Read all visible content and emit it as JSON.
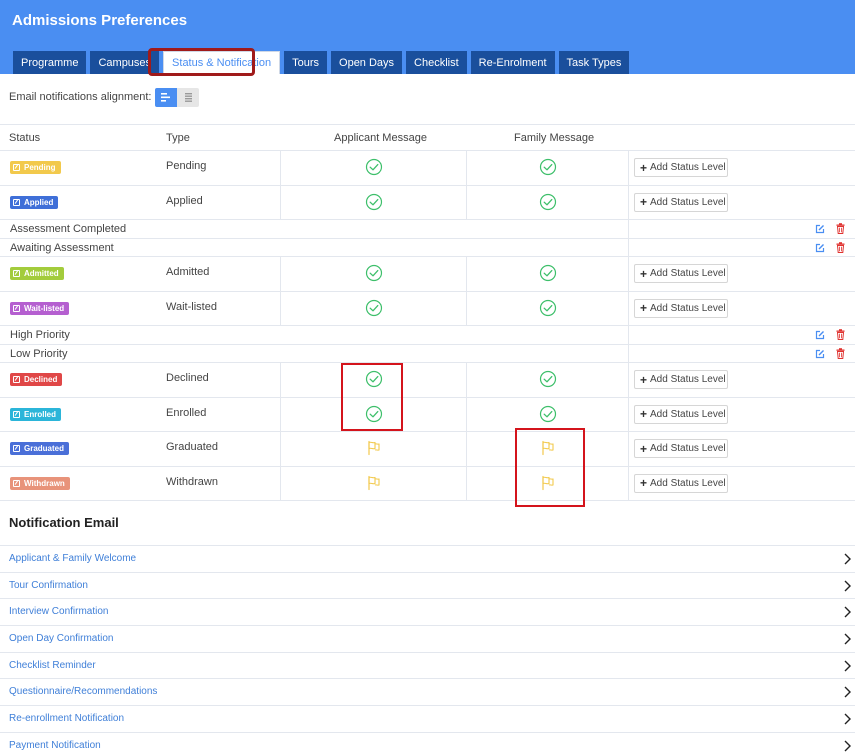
{
  "app": {
    "title": "Admissions Preferences"
  },
  "tabs": [
    {
      "label": "Programme",
      "active": false
    },
    {
      "label": "Campuses",
      "active": false
    },
    {
      "label": "Status & Notification",
      "active": true
    },
    {
      "label": "Tours",
      "active": false
    },
    {
      "label": "Open Days",
      "active": false
    },
    {
      "label": "Checklist",
      "active": false
    },
    {
      "label": "Re-Enrolment",
      "active": false
    },
    {
      "label": "Task Types",
      "active": false
    }
  ],
  "alignment": {
    "label": "Email notifications alignment:",
    "selected": "left"
  },
  "table": {
    "headers": {
      "status": "Status",
      "type": "Type",
      "applicant": "Applicant Message",
      "family": "Family Message"
    },
    "add_label": "Add Status Level",
    "rows": [
      {
        "kind": "status",
        "badge": "Pending",
        "color": "#f2c94c",
        "type": "Pending",
        "applicant": "check",
        "family": "check"
      },
      {
        "kind": "status",
        "badge": "Applied",
        "color": "#3f6fd8",
        "type": "Applied",
        "applicant": "check",
        "family": "check"
      },
      {
        "kind": "level",
        "label": "Assessment Completed"
      },
      {
        "kind": "level",
        "label": "Awaiting Assessment"
      },
      {
        "kind": "status",
        "badge": "Admitted",
        "color": "#a3cc3c",
        "type": "Admitted",
        "applicant": "check",
        "family": "check"
      },
      {
        "kind": "status",
        "badge": "Wait-listed",
        "color": "#b55fd0",
        "type": "Wait-listed",
        "applicant": "check",
        "family": "check"
      },
      {
        "kind": "level",
        "label": "High Priority"
      },
      {
        "kind": "level",
        "label": "Low Priority"
      },
      {
        "kind": "status",
        "badge": "Declined",
        "color": "#e04747",
        "type": "Declined",
        "applicant": "check",
        "family": "check"
      },
      {
        "kind": "status",
        "badge": "Enrolled",
        "color": "#2bb5d9",
        "type": "Enrolled",
        "applicant": "check",
        "family": "check"
      },
      {
        "kind": "status",
        "badge": "Graduated",
        "color": "#4a6fd8",
        "type": "Graduated",
        "applicant": "flag",
        "family": "flag"
      },
      {
        "kind": "status",
        "badge": "Withdrawn",
        "color": "#e8937a",
        "type": "Withdrawn",
        "applicant": "flag",
        "family": "flag"
      }
    ]
  },
  "colors": {
    "accent": "#4a8ef2",
    "check": "#3dbf6a",
    "flag": "#f2c94c",
    "delete": "#e0322f",
    "highlight": "#d4141c"
  },
  "icons": {
    "check": "check-circle-icon",
    "flag": "flag-icon",
    "edit": "edit-icon",
    "delete": "trash-icon",
    "chevron": "chevron-right-icon"
  },
  "notifications": {
    "title": "Notification Email",
    "items": [
      "Applicant & Family Welcome",
      "Tour Confirmation",
      "Interview Confirmation",
      "Open Day Confirmation",
      "Checklist Reminder",
      "Questionnaire/Recommendations",
      "Re-enrollment Notification",
      "Payment Notification"
    ]
  }
}
